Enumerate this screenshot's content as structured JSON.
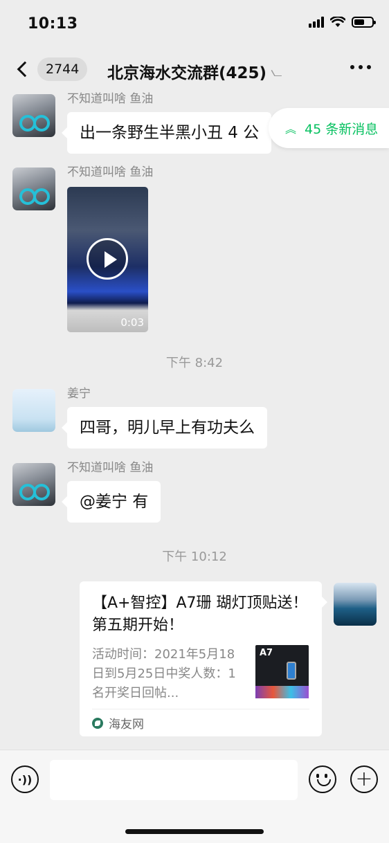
{
  "status_bar": {
    "time": "10:13"
  },
  "nav": {
    "unread_count": "2744",
    "title": "北京海水交流群(425)",
    "ear_icon": "ear-icon",
    "more_icon": "more-dots-icon"
  },
  "new_messages_banner": {
    "label": "45 条新消息",
    "icon": "double-chevron-up-icon"
  },
  "messages": [
    {
      "sender": "不知道叫啥 鱼油",
      "text": "出一条野生半黑小丑 4 公",
      "type": "text"
    },
    {
      "sender": "不知道叫啥 鱼油",
      "type": "video",
      "duration": "0:03"
    },
    {
      "sender": "姜宁",
      "text": "四哥，明儿早上有功夫么",
      "type": "text"
    },
    {
      "sender": "不知道叫啥 鱼油",
      "text": "@姜宁 有",
      "type": "text"
    }
  ],
  "timestamps": [
    "下午 8:42",
    "下午 10:12"
  ],
  "link_card": {
    "title": "【A+智控】A7珊 瑚灯顶贴送！第五期开始！",
    "description": "活动时间：2021年5月18日到5月25日中奖人数：1名开奖日回帖...",
    "thumb_label": "A7",
    "source": "海友网"
  },
  "input_bar": {
    "voice_icon": "voice-icon",
    "emoji_icon": "emoji-icon",
    "plus_icon": "plus-icon",
    "text_value": ""
  },
  "colors": {
    "accent_green": "#07c160",
    "background": "#ededed"
  }
}
